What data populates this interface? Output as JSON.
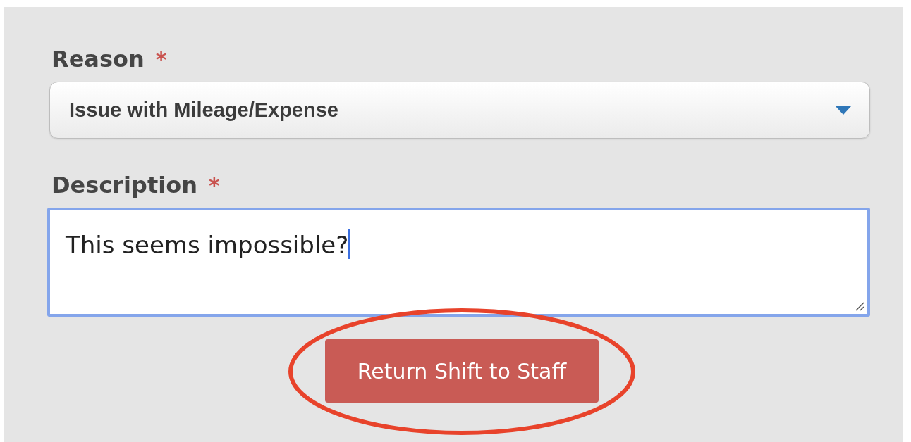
{
  "form": {
    "fields": [
      {
        "kind": "select",
        "label": "Reason",
        "required_mark": "*",
        "value": "Issue with Mileage/Expense"
      },
      {
        "kind": "textarea",
        "label": "Description",
        "required_mark": "*",
        "value": "This seems impossible?",
        "focused": true
      }
    ],
    "submit": {
      "label": "Return Shift to Staff",
      "circled": true
    }
  }
}
